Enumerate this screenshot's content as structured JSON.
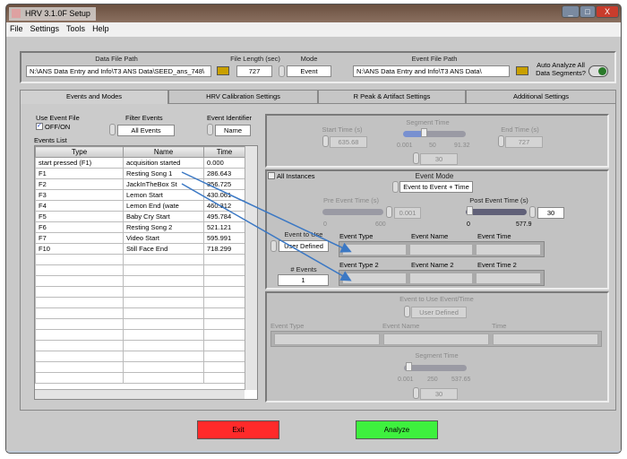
{
  "window": {
    "title": "HRV 3.1.0F Setup",
    "min": "_",
    "max": "□",
    "close": "X"
  },
  "menu": [
    "File",
    "Settings",
    "Tools",
    "Help"
  ],
  "top": {
    "data_file_label": "Data File Path",
    "data_file": "N:\\ANS Data Entry and Info\\T3 ANS Data\\SEED_ans_748\\",
    "file_length_label": "File Length (sec)",
    "file_length": "727",
    "mode_label": "Mode",
    "mode": "Event",
    "event_file_label": "Event File Path",
    "event_file": "N:\\ANS Data Entry and Info\\T3 ANS Data\\",
    "auto_label": "Auto Analyze All Data Segments?"
  },
  "tabs": [
    "Events and Modes",
    "HRV Calibration Settings",
    "R Peak & Artifact Settings",
    "Additional Settings"
  ],
  "left": {
    "use_event_file": "Use Event File",
    "offon": "OFF/ON",
    "filter_label": "Filter Events",
    "filter": "All Events",
    "identifier_label": "Event Identifier",
    "identifier": "Name",
    "events_list": "Events List",
    "columns": [
      "Type",
      "Name",
      "Time"
    ],
    "rows": [
      [
        "start pressed (F1)",
        "acquisition started",
        "0.000"
      ],
      [
        "F1",
        "Resting Song 1",
        "286.643"
      ],
      [
        "F2",
        "JackInTheBox St",
        "356.725"
      ],
      [
        "F3",
        "Lemon Start",
        "430.061"
      ],
      [
        "F4",
        "Lemon End (wate",
        "460.312"
      ],
      [
        "F5",
        "Baby Cry Start",
        "495.784"
      ],
      [
        "F6",
        "Resting Song 2",
        "521.121"
      ],
      [
        "F7",
        "Video Start",
        "595.991"
      ],
      [
        "F10",
        "Still Face End",
        "718.299"
      ]
    ]
  },
  "segment": {
    "start_label": "Start Time (s)",
    "start": "635.68",
    "seg_label": "Segment Time",
    "ticks": [
      "0.001",
      "50",
      "91.32"
    ],
    "seg": "30",
    "end_label": "End Time (s)",
    "end": "727"
  },
  "event": {
    "all_instances": "All Instances",
    "mode_label": "Event Mode",
    "mode": "Event to Event + Time",
    "pre_label": "Pre Event Time (s)",
    "pre": "0.001",
    "pre_ticks": [
      "0",
      "600"
    ],
    "post_label": "Post Event Time (s)",
    "post": "30",
    "post_ticks": [
      "0",
      "577.9"
    ],
    "use_label": "Event to Use",
    "use": "User Defined",
    "num_label": "# Events",
    "num": "1",
    "type": "Event Type",
    "name": "Event Name",
    "time": "Event Time",
    "type2": "Event Type 2",
    "name2": "Event Name 2",
    "time2": "Event Time 2"
  },
  "bottom": {
    "use_label": "Event to Use Event/Time",
    "use": "User Defined",
    "type": "Event Type",
    "name": "Event Name",
    "time": "Time",
    "seg_label": "Segment Time",
    "ticks": [
      "0.001",
      "250",
      "537.65"
    ],
    "seg": "30"
  },
  "buttons": {
    "exit": "Exit",
    "analyze": "Analyze"
  },
  "colors": {
    "exit": "#ff2a2a",
    "analyze": "#3ef03e",
    "arrow": "#3b78c4"
  }
}
